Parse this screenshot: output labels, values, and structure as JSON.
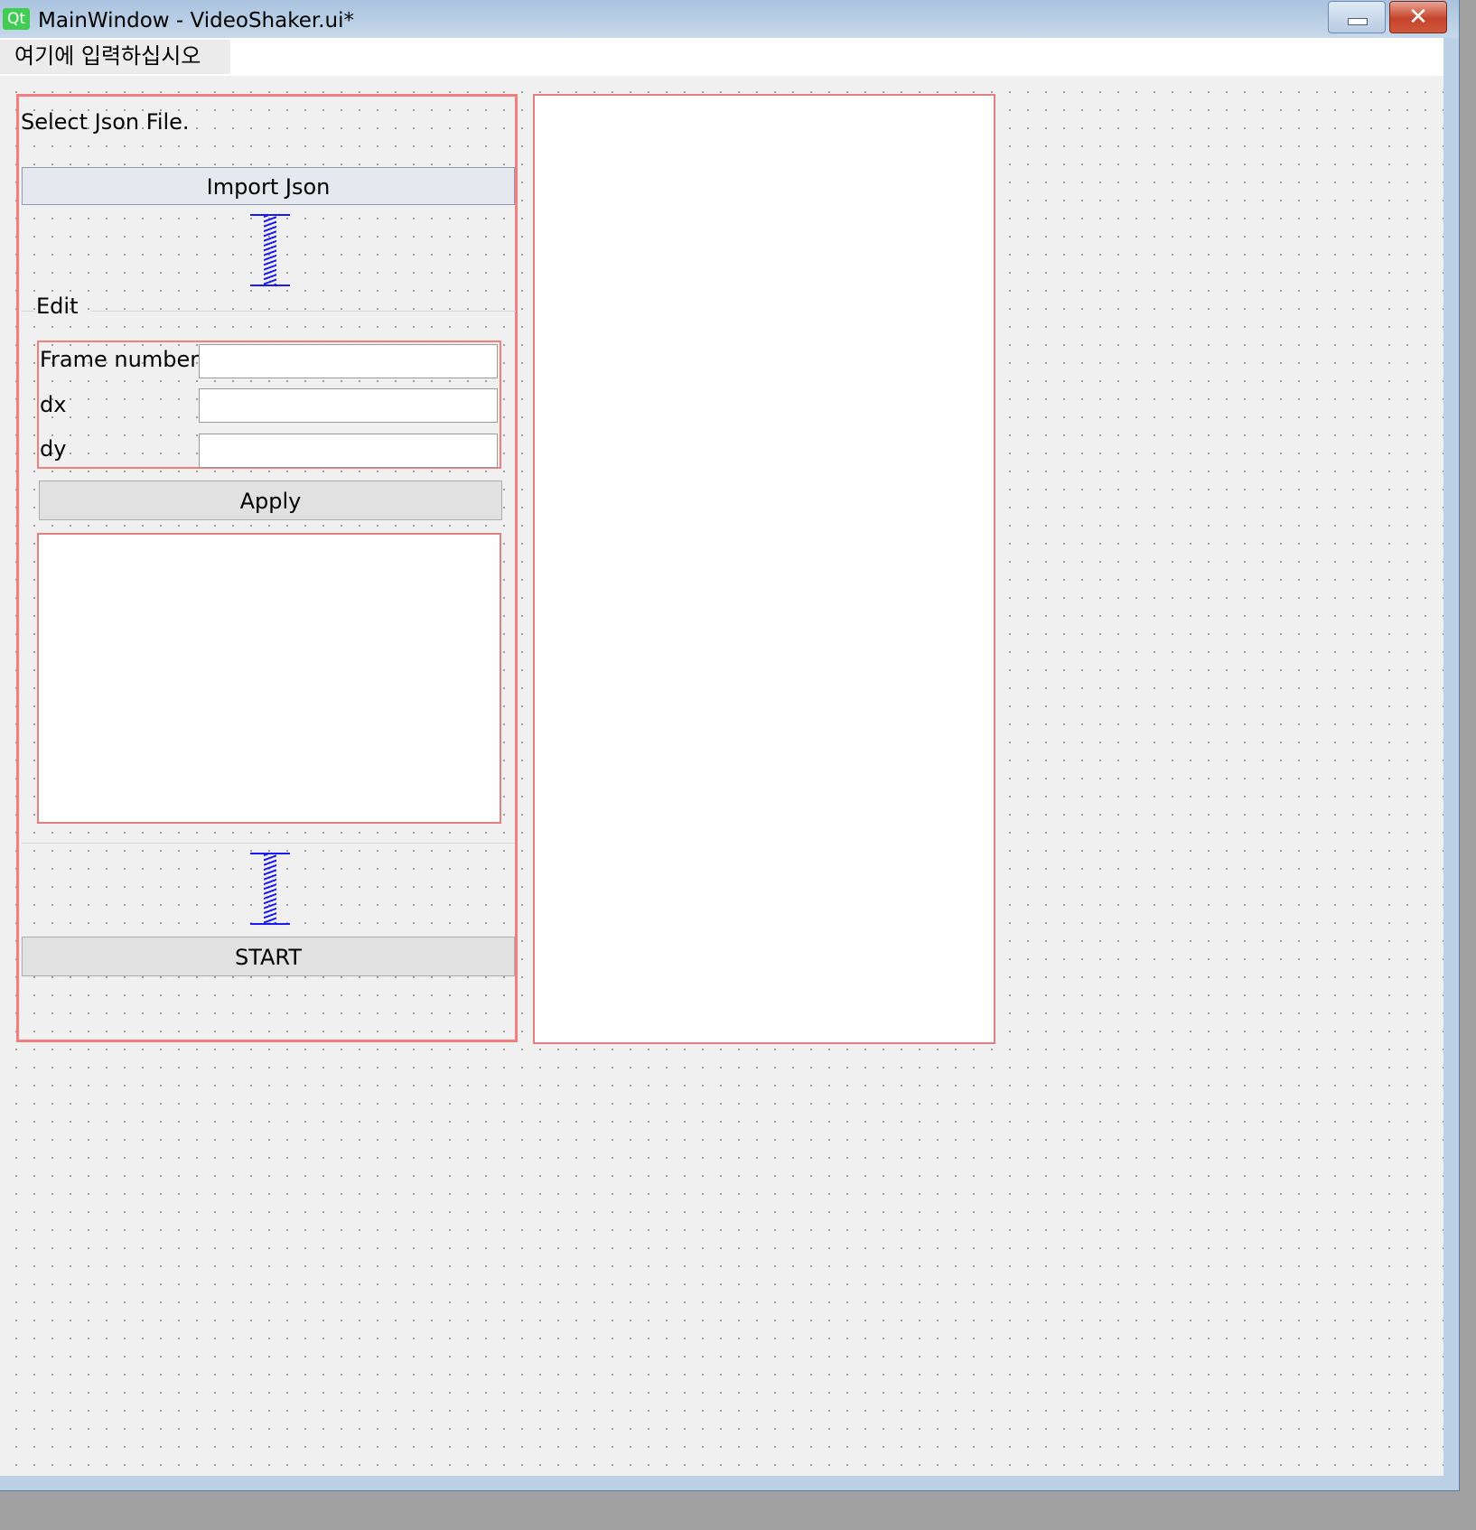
{
  "window": {
    "title": "MainWindow - VideoShaker.ui*",
    "logo_text": "Qt",
    "minimize_symbol": "",
    "close_symbol": "✕"
  },
  "menubar": {
    "entry_placeholder": "여기에 입력하십시오"
  },
  "left_panel": {
    "select_label": "Select Json File.",
    "import_button": "Import Json",
    "edit_group_title": "Edit",
    "form": {
      "frame_number_label": "Frame number",
      "frame_number_value": "",
      "dx_label": "dx",
      "dx_value": "",
      "dy_label": "dy",
      "dy_value": ""
    },
    "apply_button": "Apply",
    "start_button": "START"
  },
  "colors": {
    "layout_outline": "#f47e7e",
    "spacer": "#1a1af0",
    "qt_green": "#41cd52"
  },
  "icons": {
    "spacer_icon": "vertical-spacer-icon",
    "close_icon": "close-icon",
    "minimize_icon": "minimize-icon"
  }
}
